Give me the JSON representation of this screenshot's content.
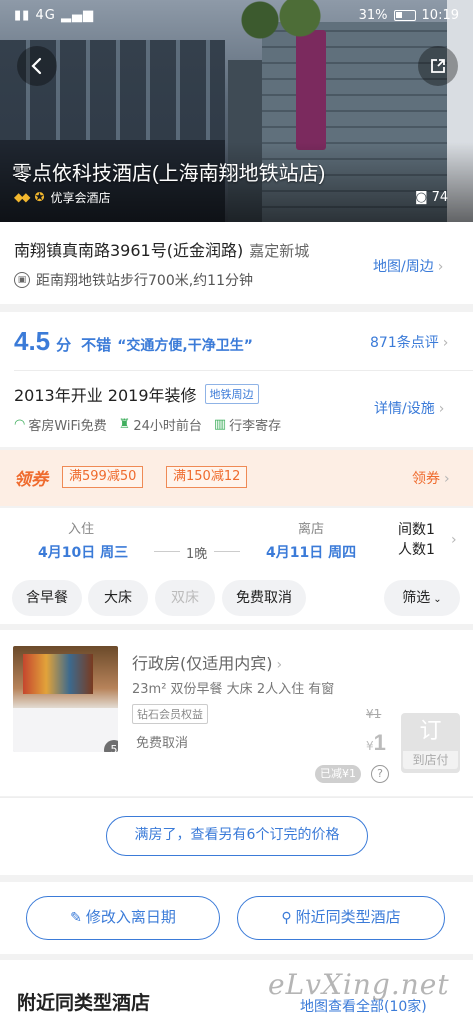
{
  "status_bar": {
    "left": "4G",
    "battery": "31%",
    "time": "10:19"
  },
  "hero": {
    "hotel_name": "零点依科技酒店(上海南翔地铁站店)",
    "member_label": "优享会酒店",
    "photo_count": "74"
  },
  "address": {
    "main": "南翔镇真南路3961号(近金润路)",
    "district": "嘉定新城",
    "distance": "距南翔地铁站步行700米,约11分钟",
    "map_link": "地图/周边"
  },
  "score": {
    "value": "4.5",
    "unit": "分",
    "word": "不错",
    "quote": "“交通方便,干净卫生”",
    "reviews": "871条点评",
    "year_info": "2013年开业 2019年装修",
    "tag": "地铁周边",
    "facilities": [
      "客房WiFi免费",
      "24小时前台",
      "行李寄存"
    ],
    "detail_link": "详情/设施"
  },
  "coupon": {
    "title": "领券",
    "tags": [
      "满599减50",
      "满150减12"
    ],
    "link": "领券"
  },
  "dates": {
    "checkin_label": "入住",
    "checkin": "4月10日 周三",
    "nights": "1晚",
    "checkout_label": "离店",
    "checkout": "4月11日 周四",
    "rooms": "间数1",
    "guests": "人数1"
  },
  "filters": {
    "chips": [
      "含早餐",
      "大床",
      "双床",
      "免费取消"
    ],
    "more": "筛选"
  },
  "room": {
    "name": "行政房(仅适用内宾)",
    "spec": "23m² 双份早餐 大床 2人入住 有窗",
    "tag": "钻石会员权益",
    "cancel": "免费取消",
    "photo_count": "5",
    "price_old": "¥1",
    "price_currency": "¥",
    "price_now": "1",
    "book": "订",
    "book_sub": "到店付",
    "discount": "已减¥1"
  },
  "sold_out": "满房了，查看另有6个订完的价格",
  "actions": {
    "modify_dates": "修改入离日期",
    "nearby_same": "附近同类型酒店"
  },
  "nearby": {
    "title": "附近同类型酒店",
    "map_link": "地图查看全部(10家)"
  },
  "watermark": "eLvXing.net",
  "colors": {
    "accent_blue": "#3b7bd8",
    "coupon_orange": "#ef6b2e"
  }
}
